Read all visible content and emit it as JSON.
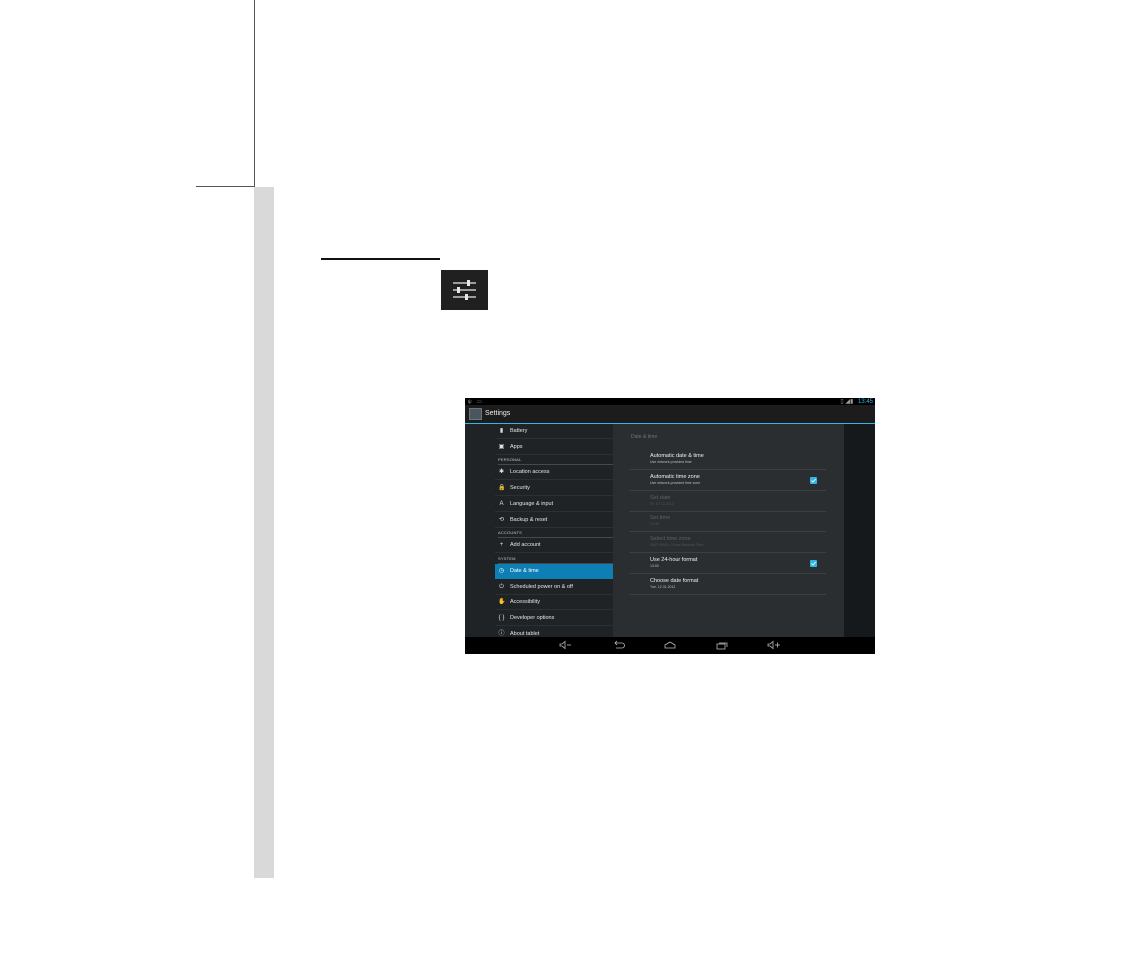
{
  "colors": {
    "accent": "#33b5e5",
    "selected": "#0e7fb4",
    "margin_gray": "#d9d9d9"
  },
  "heading_icon": "settings-sliders-icon",
  "tablet": {
    "statusbar": {
      "left_icons": [
        "ψ",
        "▭"
      ],
      "right_icons": "▯ ◢▮",
      "time": "13:45"
    },
    "actionbar": {
      "title": "Settings"
    },
    "sidebar": {
      "items": [
        {
          "label": "Battery",
          "icon": "battery-icon",
          "glyph": "▮"
        },
        {
          "label": "Apps",
          "icon": "apps-icon",
          "glyph": "▣"
        },
        {
          "header": "PERSONAL"
        },
        {
          "label": "Location access",
          "icon": "location-icon",
          "glyph": "✱"
        },
        {
          "label": "Security",
          "icon": "lock-icon",
          "glyph": "🔒"
        },
        {
          "label": "Language & input",
          "icon": "language-icon",
          "glyph": "A"
        },
        {
          "label": "Backup & reset",
          "icon": "backup-icon",
          "glyph": "⟲"
        },
        {
          "header": "ACCOUNTS"
        },
        {
          "label": "Add account",
          "icon": "plus-icon",
          "glyph": "+"
        },
        {
          "header": "SYSTEM"
        },
        {
          "label": "Date & time",
          "icon": "clock-icon",
          "glyph": "◷",
          "selected": true
        },
        {
          "label": "Scheduled power on & off",
          "icon": "power-icon",
          "glyph": "⏻"
        },
        {
          "label": "Accessibility",
          "icon": "hand-icon",
          "glyph": "✋"
        },
        {
          "label": "Developer options",
          "icon": "braces-icon",
          "glyph": "{ }"
        },
        {
          "label": "About tablet",
          "icon": "info-icon",
          "glyph": "ⓘ"
        }
      ]
    },
    "detail": {
      "header": "Date & time",
      "prefs": [
        {
          "title": "Automatic date & time",
          "summary": "Use network-provided time",
          "checked": false,
          "enabled": true
        },
        {
          "title": "Automatic time zone",
          "summary": "Use network-provided time zone",
          "checked": true,
          "enabled": true
        },
        {
          "title": "Set date",
          "summary": "Fri, 07.12.2012",
          "checked": false,
          "enabled": false
        },
        {
          "title": "Set time",
          "summary": "13:45",
          "checked": false,
          "enabled": false
        },
        {
          "title": "Select time zone",
          "summary": "GMT+08:00, China Standard Time",
          "checked": false,
          "enabled": false
        },
        {
          "title": "Use 24-hour format",
          "summary": "13:00",
          "checked": true,
          "enabled": true
        },
        {
          "title": "Choose date format",
          "summary": "Tue, 12.31.2012",
          "checked": false,
          "enabled": true
        }
      ]
    },
    "navbar": [
      "volume-down-icon",
      "back-icon",
      "home-icon",
      "recents-icon",
      "volume-up-icon"
    ]
  }
}
